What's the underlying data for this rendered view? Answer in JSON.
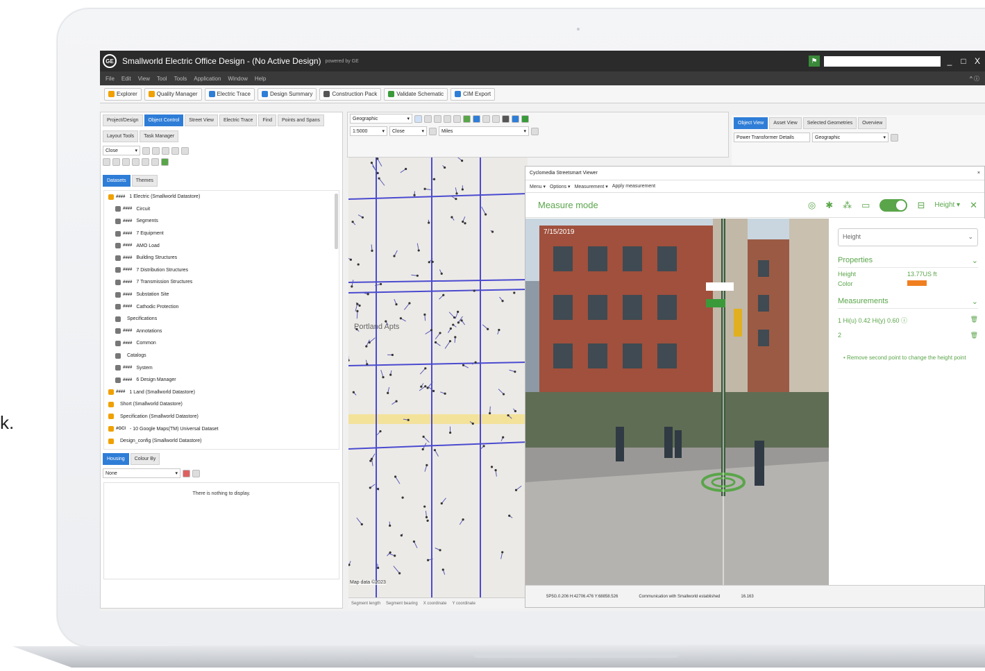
{
  "side_text": "k.",
  "app": {
    "logo": "GE",
    "title": "Smallworld Electric Office Design - (No Active Design)",
    "powered": "powered by GE",
    "window_controls": [
      "_",
      "□",
      "X"
    ]
  },
  "menu": {
    "items": [
      "File",
      "Edit",
      "View",
      "Tool",
      "Tools",
      "Application",
      "Window",
      "Help"
    ],
    "right": "^ ⓘ"
  },
  "toolbar": {
    "buttons": [
      "Explorer",
      "Quality Manager",
      "Electric Trace",
      "Design Summary",
      "Construction Pack",
      "Validate Schematic",
      "CIM Export"
    ],
    "colors": [
      "#f0a000",
      "#f0a000",
      "#2e7dd7",
      "#2e7dd7",
      "#555555",
      "#3a9a3a",
      "#2e7dd7"
    ]
  },
  "left_panel": {
    "tabs": [
      "Project/Design",
      "Object Control",
      "Street View",
      "Electric Trace",
      "Find",
      "Points and Spans"
    ],
    "subtabs": [
      "Layout Tools",
      "Task Manager"
    ],
    "select_value": "Close",
    "view_tabs": [
      "Datasets",
      "Themes"
    ],
    "tree": [
      {
        "code": "####",
        "label": "1 Electric (Smallworld Datastore)",
        "color": "#f0a000",
        "indent": 0
      },
      {
        "code": "####",
        "label": "Circuit",
        "color": "#777777",
        "indent": 1
      },
      {
        "code": "####",
        "label": "Segments",
        "color": "#777777",
        "indent": 1
      },
      {
        "code": "####",
        "label": "7 Equipment",
        "color": "#777777",
        "indent": 1
      },
      {
        "code": "####",
        "label": "AMO Load",
        "color": "#777777",
        "indent": 1
      },
      {
        "code": "####",
        "label": "Building Structures",
        "color": "#777777",
        "indent": 1
      },
      {
        "code": "####",
        "label": "7 Distribution Structures",
        "color": "#777777",
        "indent": 1
      },
      {
        "code": "####",
        "label": "7 Transmission Structures",
        "color": "#777777",
        "indent": 1
      },
      {
        "code": "####",
        "label": "Substation Site",
        "color": "#777777",
        "indent": 1
      },
      {
        "code": "####",
        "label": "Cathodic Protection",
        "color": "#777777",
        "indent": 1
      },
      {
        "code": "",
        "label": "Specifications",
        "color": "#777777",
        "indent": 1
      },
      {
        "code": "####",
        "label": "Annotations",
        "color": "#777777",
        "indent": 1
      },
      {
        "code": "####",
        "label": "Common",
        "color": "#777777",
        "indent": 1
      },
      {
        "code": "",
        "label": "Catalogs",
        "color": "#777777",
        "indent": 1
      },
      {
        "code": "####",
        "label": "System",
        "color": "#777777",
        "indent": 1
      },
      {
        "code": "####",
        "label": "6 Design Manager",
        "color": "#777777",
        "indent": 1
      },
      {
        "code": "####",
        "label": "1 Land (Smallworld Datastore)",
        "color": "#f0a000",
        "indent": 0
      },
      {
        "code": "",
        "label": "Short (Smallworld Datastore)",
        "color": "#f0a000",
        "indent": 0
      },
      {
        "code": "",
        "label": "Specification (Smallworld Datastore)",
        "color": "#f0a000",
        "indent": 0
      },
      {
        "code": "#GCI",
        "label": "- 10 Google Maps(TM) Universal Dataset",
        "color": "#f0a000",
        "indent": 0
      },
      {
        "code": "",
        "label": "Design_config (Smallworld Datastore)",
        "color": "#f0a000",
        "indent": 0
      }
    ],
    "bottom_tabs": [
      "Housing",
      "Colour By"
    ],
    "bottom_select": "None",
    "empty_message": "There is nothing to display."
  },
  "map_panel": {
    "projection": "Geographic",
    "scale": "1:5000",
    "scale_mode": "Close",
    "units": "Miles",
    "labels": [
      "Portland Apts"
    ],
    "map_date": "Map data ©2023",
    "status": [
      "Segment length",
      "Segment bearing",
      "X coordinate",
      "Y coordinate"
    ]
  },
  "right_panel": {
    "tabs": [
      "Object View",
      "Asset View",
      "Selected Geometries",
      "Overview"
    ],
    "select_value": "Power Transformer Details",
    "projection": "Geographic"
  },
  "viewer": {
    "title": "Cyclomedia Streetsmart Viewer",
    "menu": [
      "Menu ▾",
      "Options ▾",
      "Measurement ▾",
      "Apply measurement"
    ],
    "mode": "Measure mode",
    "height_label": "Height ▾",
    "date": "7/15/2019",
    "search_value": "Height",
    "properties_heading": "Properties",
    "props": [
      {
        "label": "Height",
        "value": "13.77US ft"
      },
      {
        "label": "Color",
        "value": ""
      }
    ],
    "color_swatch": "#f07f20",
    "measurements_heading": "Measurements",
    "measurements": [
      "1 Hi(u) 0.42 Hi(y) 0.60 ⓘ",
      "2"
    ],
    "hint": "• Remove second point to change the height point",
    "status": [
      "5P5G.0.206 H:42706.476 Y:68858.526",
      "Communication with Smallworld established",
      "16.163"
    ]
  }
}
